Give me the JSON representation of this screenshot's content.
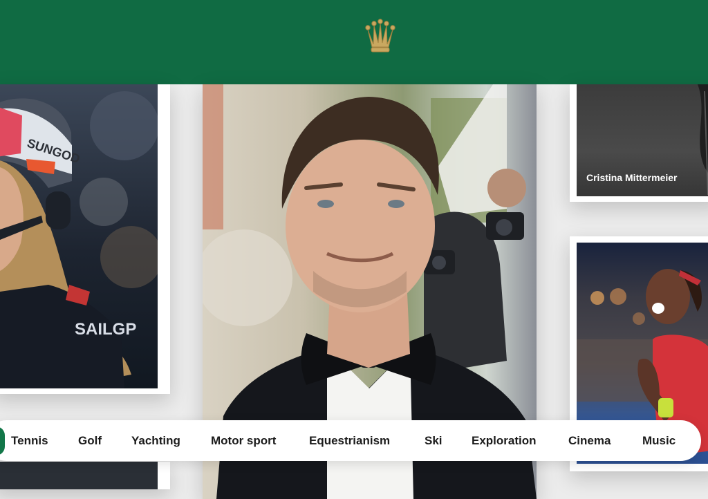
{
  "brand": {
    "logo_icon": "crown-icon",
    "header_color": "#106b43",
    "accent_color": "#127749",
    "crown_color": "#c9a860"
  },
  "cards": {
    "right_top": {
      "caption": "Cristina Mittermeier"
    },
    "left": {
      "helmet_text": "SUNGOD",
      "jersey_text": "SAILGP"
    }
  },
  "nav": {
    "items": [
      {
        "label": "Tennis"
      },
      {
        "label": "Golf"
      },
      {
        "label": "Yachting"
      },
      {
        "label": "Motor sport"
      },
      {
        "label": "Equestrianism"
      },
      {
        "label": "Ski"
      },
      {
        "label": "Exploration"
      },
      {
        "label": "Cinema"
      },
      {
        "label": "Music"
      }
    ]
  }
}
